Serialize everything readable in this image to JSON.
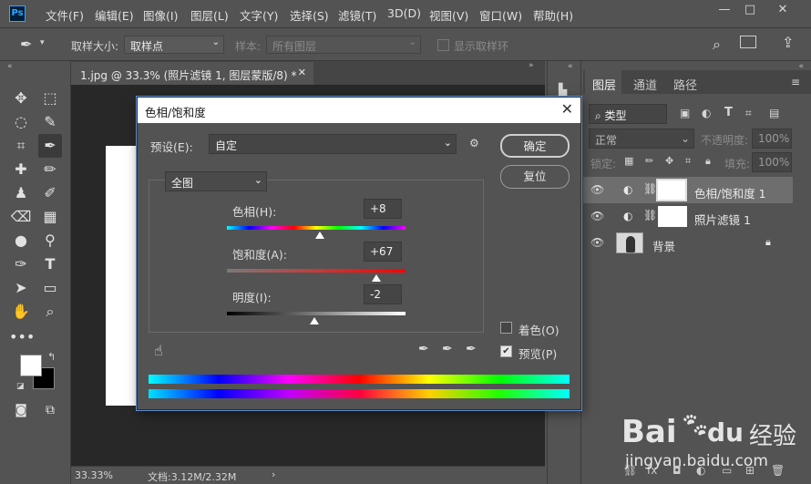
{
  "app": {
    "logo": "Ps"
  },
  "menubar": {
    "items": [
      "文件(F)",
      "编辑(E)",
      "图像(I)",
      "图层(L)",
      "文字(Y)",
      "选择(S)",
      "滤镜(T)",
      "3D(D)",
      "视图(V)",
      "窗口(W)",
      "帮助(H)"
    ],
    "window_controls": {
      "minimize": "—",
      "maximize": "□",
      "close": "✕"
    }
  },
  "options_bar": {
    "sample_size_label": "取样大小:",
    "sample_size_value": "取样点",
    "sample_label": "样本:",
    "sample_value": "所有图层",
    "show_ring_label": "显示取样环"
  },
  "document": {
    "tab_title": "1.jpg @ 33.3% (照片滤镜 1, 图层蒙版/8) *",
    "tab_close": "✕",
    "zoom": "33.33%",
    "doc_info": "文档:3.12M/2.32M"
  },
  "layers_panel": {
    "tabs": [
      "图层",
      "通道",
      "路径"
    ],
    "filter_kind": "类型",
    "blend_mode": "正常",
    "opacity_label": "不透明度:",
    "opacity_value": "100%",
    "lock_label": "锁定:",
    "fill_label": "填充:",
    "fill_value": "100%",
    "layers": [
      {
        "name": "色相/饱和度 1",
        "selected": true
      },
      {
        "name": "照片滤镜 1",
        "selected": false
      },
      {
        "name": "背景",
        "selected": false,
        "locked": true
      }
    ]
  },
  "dialog": {
    "title": "色相/饱和度",
    "close": "✕",
    "preset_label": "预设(E):",
    "preset_value": "自定",
    "channel_value": "全图",
    "hue_label": "色相(H):",
    "hue_value": "+8",
    "saturation_label": "饱和度(A):",
    "saturation_value": "+67",
    "lightness_label": "明度(I):",
    "lightness_value": "-2",
    "ok_button": "确定",
    "reset_button": "复位",
    "colorize_label": "着色(O)",
    "colorize_checked": false,
    "preview_label": "预览(P)",
    "preview_checked": true,
    "slider_levels": {
      "hue": 8,
      "hue_range": [
        -180,
        180
      ],
      "saturation": 67,
      "saturation_range": [
        -100,
        100
      ],
      "lightness": -2,
      "lightness_range": [
        -100,
        100
      ]
    }
  },
  "watermark": {
    "brand": "Bai",
    "brand_suffix": "du",
    "cn": "经验",
    "url": "jingyan.baidu.com"
  }
}
